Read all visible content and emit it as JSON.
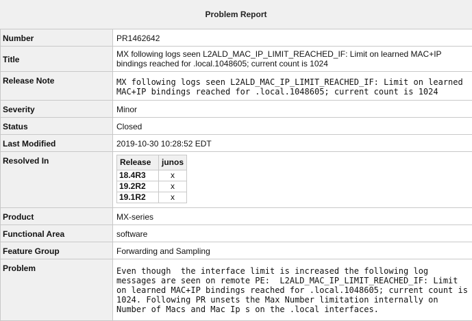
{
  "header": {
    "title": "Problem Report"
  },
  "fields": {
    "number": {
      "label": "Number",
      "value": "PR1462642"
    },
    "title": {
      "label": "Title",
      "value": "MX following logs seen L2ALD_MAC_IP_LIMIT_REACHED_IF: Limit on learned MAC+IP bindings reached for .local.1048605; current count is 1024"
    },
    "release_note": {
      "label": "Release Note",
      "value": "MX following logs seen L2ALD_MAC_IP_LIMIT_REACHED_IF: Limit on learned\nMAC+IP bindings reached for .local.1048605; current count is 1024"
    },
    "severity": {
      "label": "Severity",
      "value": "Minor"
    },
    "status": {
      "label": "Status",
      "value": "Closed"
    },
    "last_modified": {
      "label": "Last Modified",
      "value": "2019-10-30 10:28:52 EDT"
    },
    "resolved_in": {
      "label": "Resolved In",
      "columns": [
        "Release",
        "junos"
      ],
      "rows": [
        {
          "release": "18.4R3",
          "junos": "x"
        },
        {
          "release": "19.2R2",
          "junos": "x"
        },
        {
          "release": "19.1R2",
          "junos": "x"
        }
      ]
    },
    "product": {
      "label": "Product",
      "value": "MX-series"
    },
    "functional_area": {
      "label": "Functional Area",
      "value": "software"
    },
    "feature_group": {
      "label": "Feature Group",
      "value": "Forwarding and Sampling"
    },
    "problem": {
      "label": "Problem",
      "value": "Even though  the interface limit is increased the following log\nmessages are seen on remote PE:  L2ALD_MAC_IP_LIMIT_REACHED_IF: Limit\non learned MAC+IP bindings reached for .local.1048605; current count is\n1024. Following PR unsets the Max Number limitation internally on\nNumber of Macs and Mac Ip s on the .local interfaces."
    }
  }
}
